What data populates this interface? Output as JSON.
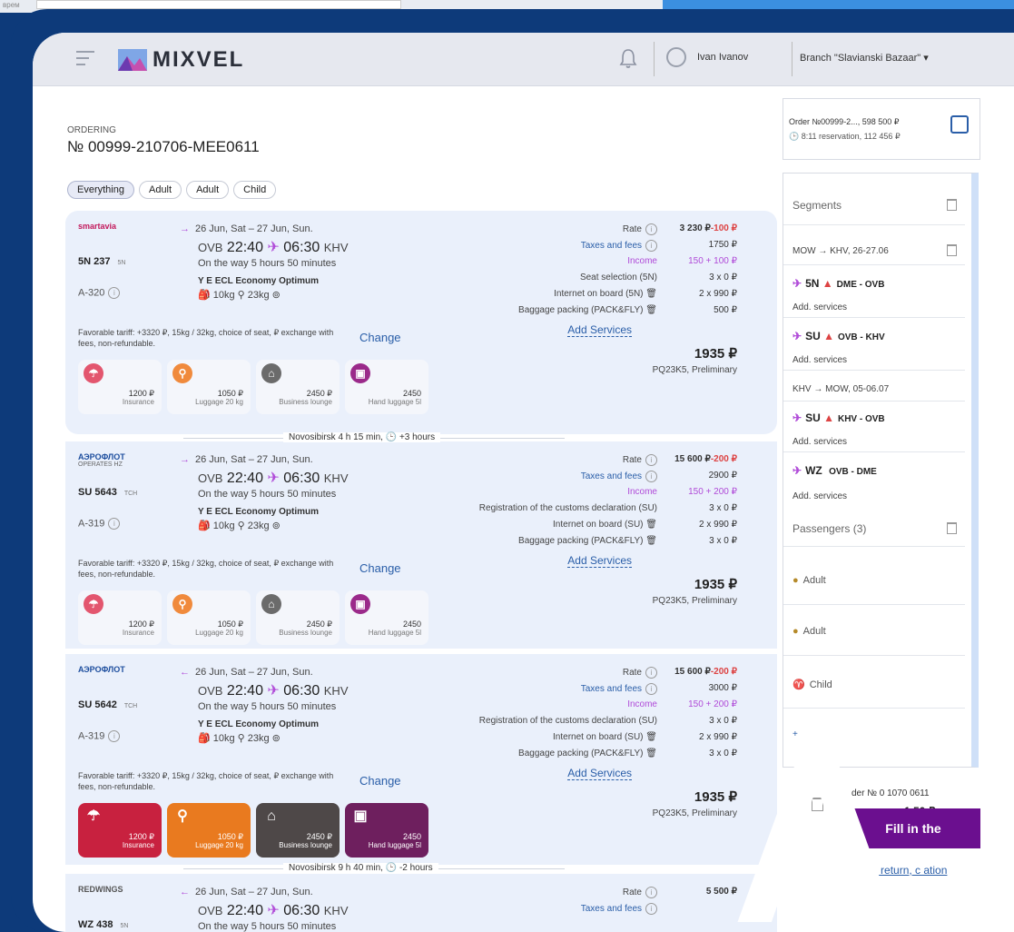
{
  "top": {
    "label": "врем"
  },
  "header": {
    "logo": "MIXVEL",
    "user": "Ivan Ivanov",
    "branch": "Branch \"Slavianski Bazaar\" ▾"
  },
  "order": {
    "label": "ORDERING",
    "number": "№ 00999-210706-MEE0611"
  },
  "filters": [
    "Everything",
    "Adult",
    "Adult",
    "Child"
  ],
  "flights": [
    {
      "airline": "smartavia",
      "operates": "",
      "flight": "5N 237",
      "sub": "5N",
      "aircraft": "A-320",
      "direction": "→",
      "dates": "26 Jun, Sat – 27 Jun, Sun.",
      "dep_ap": "OVB",
      "dep": "22:40",
      "arr": "06:30",
      "arr_ap": "KHV",
      "onway": "On the way 5 hours 50 minutes",
      "tariff": "Y E ECL Economy Optimum",
      "bags": "🎒 10kg   ⚲ 23kg   ⊚",
      "fav": "Favorable tariff: +3320 ₽, 15kg / 32kg, choice of seat, ₽ exchange with fees, non-refundable.",
      "change": "Change",
      "services_solid": false,
      "price_rows": [
        {
          "label": "Rate",
          "value": "3 230 ₽",
          "extra": "-100 ₽",
          "info": true
        },
        {
          "label": "Taxes and fees",
          "value": "1750 ₽",
          "info": true
        },
        {
          "label": "Income",
          "value": "150 + 100 ₽"
        },
        {
          "label": "Seat selection (5N)",
          "value": "3 x 0 ₽"
        },
        {
          "label": "Internet on board (5N) 🗑",
          "value": "2 x 990 ₽"
        },
        {
          "label": "Baggage packing (PACK&FLY) 🗑",
          "value": "500 ₽"
        }
      ],
      "add": "Add Services",
      "total": "1935 ₽",
      "pq": "PQ23K5, Preliminary"
    },
    {
      "airline": "АЭРОФЛОТ",
      "operates": "OPERATES HZ",
      "flight": "SU 5643",
      "sub": "TCH",
      "aircraft": "A-319",
      "direction": "→",
      "dates": "26 Jun, Sat – 27 Jun, Sun.",
      "dep_ap": "OVB",
      "dep": "22:40",
      "arr": "06:30",
      "arr_ap": "KHV",
      "onway": "On the way 5 hours 50 minutes",
      "tariff": "Y E ECL Economy Optimum",
      "bags": "🎒 10kg   ⚲ 23kg   ⊚",
      "fav": "Favorable tariff: +3320 ₽, 15kg / 32kg, choice of seat, ₽ exchange with fees, non-refundable.",
      "change": "Change",
      "services_solid": false,
      "price_rows": [
        {
          "label": "Rate",
          "value": "15 600 ₽",
          "extra": "-200 ₽",
          "info": true
        },
        {
          "label": "Taxes and fees",
          "value": "2900 ₽",
          "info": true
        },
        {
          "label": "Income",
          "value": "150 + 200 ₽"
        },
        {
          "label": "Registration of the customs declaration (SU)",
          "value": "3 x 0 ₽"
        },
        {
          "label": "Internet on board (SU) 🗑",
          "value": "2 x 990 ₽"
        },
        {
          "label": "Baggage packing (PACK&FLY) 🗑",
          "value": "3 x 0 ₽"
        }
      ],
      "add": "Add Services",
      "total": "1935 ₽",
      "pq": "PQ23K5, Preliminary"
    },
    {
      "airline": "АЭРОФЛОТ",
      "operates": "",
      "flight": "SU 5642",
      "sub": "TCH",
      "aircraft": "A-319",
      "direction": "←",
      "dates": "26 Jun, Sat – 27 Jun, Sun.",
      "dep_ap": "OVB",
      "dep": "22:40",
      "arr": "06:30",
      "arr_ap": "KHV",
      "onway": "On the way 5 hours 50 minutes",
      "tariff": "Y E ECL Economy Optimum",
      "bags": "🎒 10kg   ⚲ 23kg   ⊚",
      "fav": "Favorable tariff: +3320 ₽, 15kg / 32kg, choice of seat, ₽ exchange with fees, non-refundable.",
      "change": "Change",
      "services_solid": true,
      "price_rows": [
        {
          "label": "Rate",
          "value": "15 600 ₽",
          "extra": "-200 ₽",
          "info": true
        },
        {
          "label": "Taxes and fees",
          "value": "3000 ₽",
          "info": true
        },
        {
          "label": "Income",
          "value": "150 + 200 ₽"
        },
        {
          "label": "Registration of the customs declaration (SU)",
          "value": "3 x 0 ₽"
        },
        {
          "label": "Internet on board (SU) 🗑",
          "value": "2 x 990 ₽"
        },
        {
          "label": "Baggage packing (PACK&FLY) 🗑",
          "value": "3 x 0 ₽"
        }
      ],
      "add": "Add Services",
      "total": "1935 ₽",
      "pq": "PQ23K5, Preliminary"
    },
    {
      "airline": "REDWINGS",
      "operates": "",
      "flight": "WZ 438",
      "sub": "5N",
      "aircraft": "",
      "direction": "←",
      "dates": "26 Jun, Sat – 27 Jun, Sun.",
      "dep_ap": "OVB",
      "dep": "22:40",
      "arr": "06:30",
      "arr_ap": "KHV",
      "onway": "On the way 5 hours 50 minutes",
      "tariff": "",
      "bags": "",
      "fav": "",
      "change": "",
      "services_solid": false,
      "price_rows": [
        {
          "label": "Rate",
          "value": "5 500 ₽",
          "info": true
        },
        {
          "label": "Taxes and fees",
          "value": "",
          "info": true
        }
      ],
      "add": "",
      "total": "",
      "pq": ""
    }
  ],
  "services": [
    {
      "icon": "☂",
      "price": "1200 ₽",
      "name": "Insurance",
      "color": "#e3566e",
      "solid": "#c8213f"
    },
    {
      "icon": "⚲",
      "price": "1050 ₽",
      "name": "Luggage 20 kg",
      "color": "#f08a3c",
      "solid": "#e97a1f"
    },
    {
      "icon": "⌂",
      "price": "2450 ₽",
      "name": "Business lounge",
      "color": "#6b6b6b",
      "solid": "#4e4848"
    },
    {
      "icon": "▣",
      "price": "2450",
      "name": "Hand luggage 5l",
      "color": "#9b2a8a",
      "solid": "#6e1f5e"
    }
  ],
  "layovers": [
    {
      "text": "Novosibirsk 4 h 15 min, 🕒 +3 hours"
    },
    {
      "text": "Novosibirsk  9 h 40 min, 🕒 -2 hours"
    }
  ],
  "side": {
    "order_line1": "Order №00999-2..., 598 500 ₽",
    "order_line2": "🕒 8:11 reservation, 112 456 ₽",
    "segments_title": "Segments",
    "route1": "MOW → KHV, 26-27.06",
    "route2": "KHV → MOW, 05-06.07",
    "segs": [
      {
        "code": "5N",
        "warn": "▲",
        "route": "DME - OVB",
        "add": "Add. services"
      },
      {
        "code": "SU",
        "warn": "▲",
        "route": "OVB - KHV",
        "add": "Add. services"
      },
      {
        "code": "SU",
        "warn": "▲",
        "route": "KHV - OVB",
        "add": "Add. services"
      },
      {
        "code": "WZ",
        "warn": "",
        "route": "OVB - DME",
        "add": "Add. services"
      }
    ],
    "passengers_title": "Passengers (3)",
    "pax": [
      "Adult",
      "Adult",
      "Child"
    ],
    "plus": "+",
    "bottom_order": "der № 0   1070   0611",
    "bottom_total": "1   50 ₽",
    "fill": "Fill in the",
    "link": "hange, return, c   ation",
    "watermark": "A"
  }
}
